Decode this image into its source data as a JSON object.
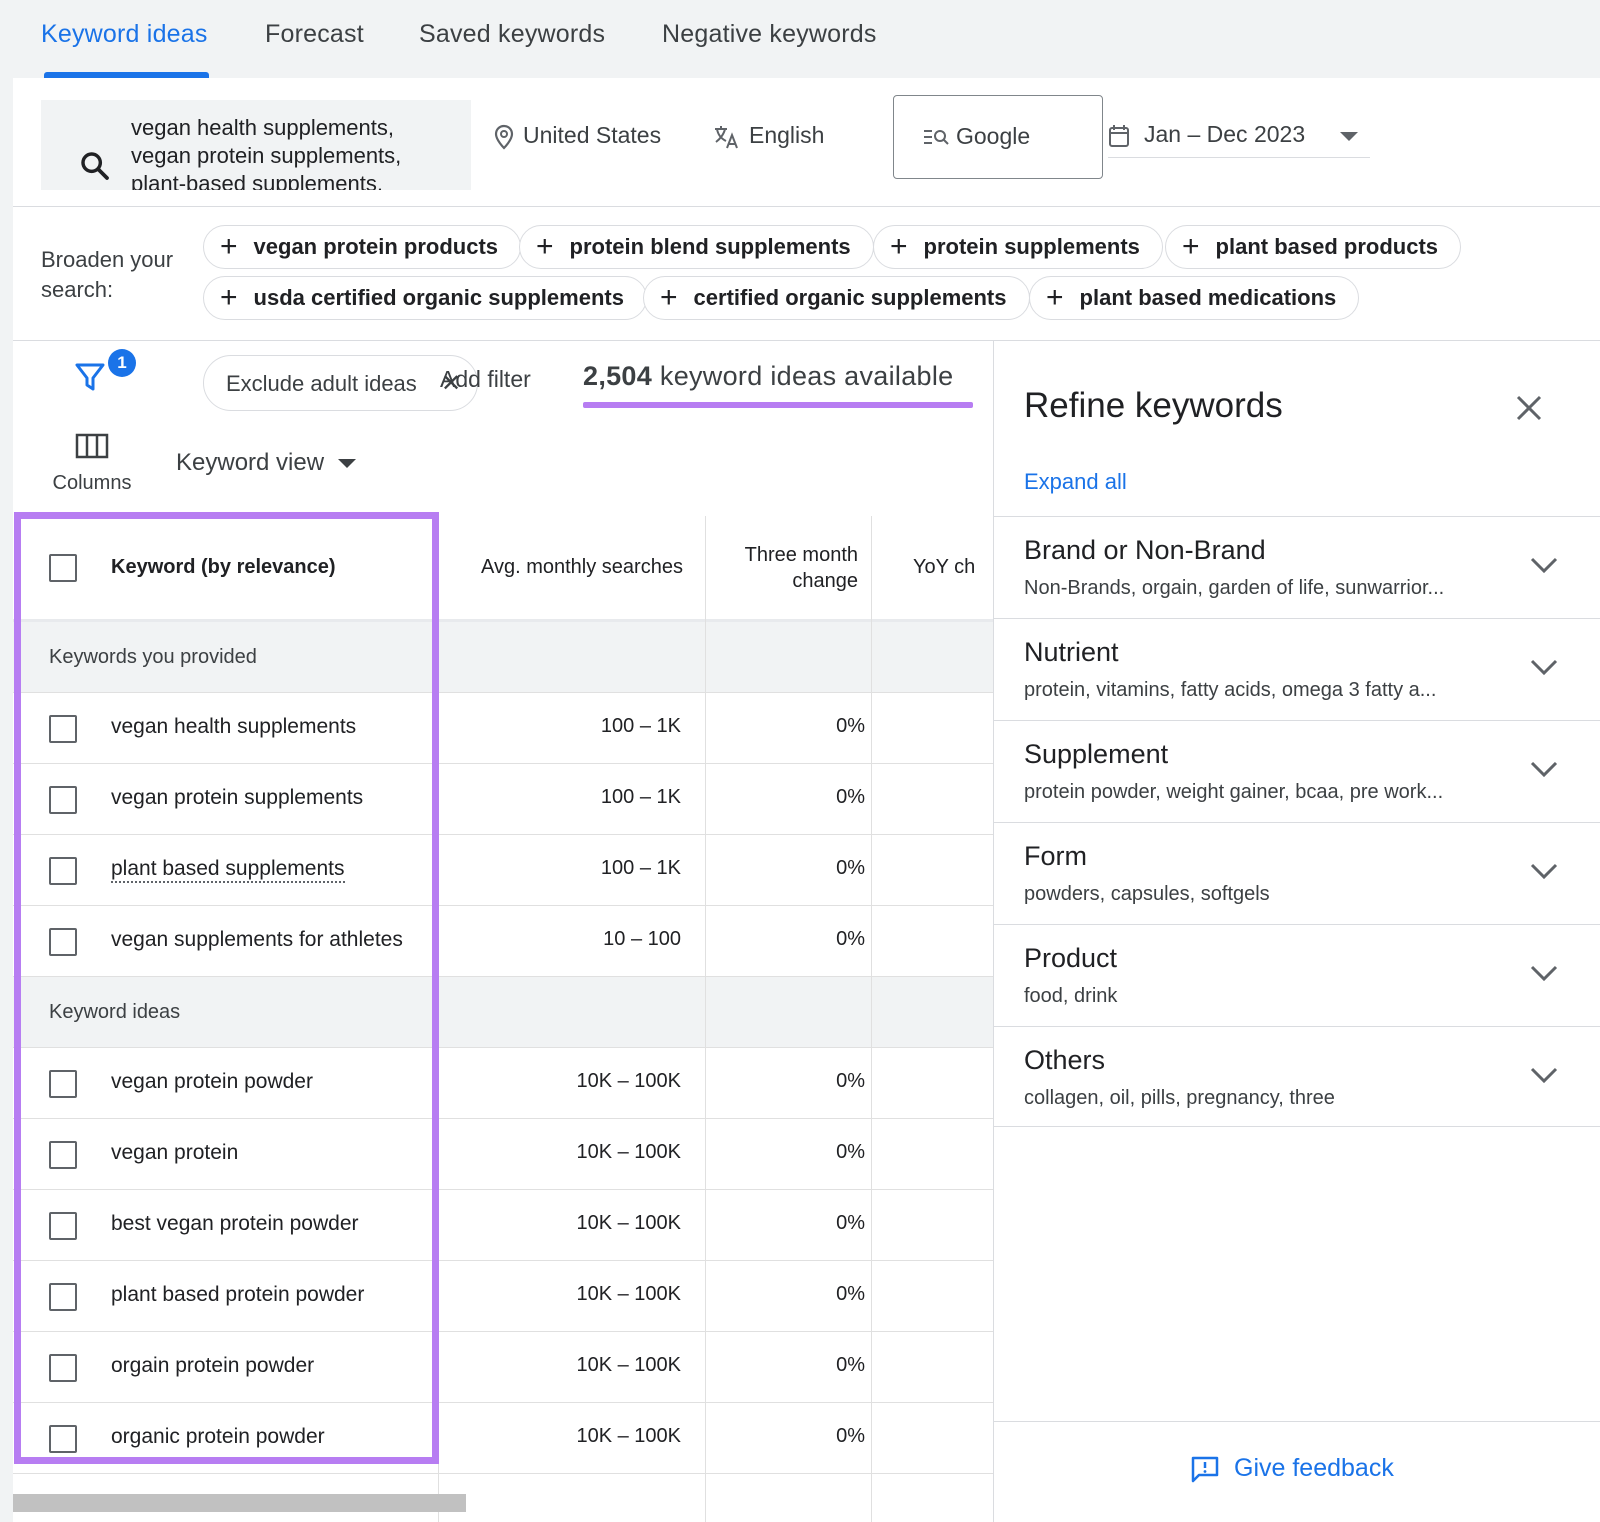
{
  "tabs": [
    {
      "label": "Keyword ideas"
    },
    {
      "label": "Forecast"
    },
    {
      "label": "Saved keywords"
    },
    {
      "label": "Negative keywords"
    }
  ],
  "search": {
    "lines": [
      "vegan health supplements,",
      "vegan protein supplements,",
      "plant-based supplements,"
    ]
  },
  "location": "United States",
  "language": "English",
  "network": "Google",
  "date_range": "Jan – Dec 2023",
  "broaden": {
    "label": "Broaden your search:",
    "chips": [
      "vegan protein products",
      "protein blend supplements",
      "protein supplements",
      "plant based products",
      "usda certified organic supplements",
      "certified organic supplements",
      "plant based medications"
    ]
  },
  "filters": {
    "badge": "1",
    "exclude_label": "Exclude adult ideas",
    "add_filter": "Add filter",
    "count_number": "2,504",
    "count_suffix": "keyword ideas available"
  },
  "columns_label": "Columns",
  "view_label": "Keyword view",
  "table": {
    "headers": {
      "keyword": "Keyword (by relevance)",
      "avg": "Avg. monthly searches",
      "three_month_1": "Three month",
      "three_month_2": "change",
      "yoy": "YoY ch"
    },
    "group_provided": "Keywords you provided",
    "group_ideas": "Keyword ideas",
    "provided": [
      {
        "keyword": "vegan health supplements",
        "avg": "100 – 1K",
        "change": "0%"
      },
      {
        "keyword": "vegan protein supplements",
        "avg": "100 – 1K",
        "change": "0%"
      },
      {
        "keyword": "plant based supplements",
        "avg": "100 – 1K",
        "change": "0%"
      },
      {
        "keyword": "vegan supplements for athletes",
        "avg": "10 – 100",
        "change": "0%"
      }
    ],
    "ideas": [
      {
        "keyword": "vegan protein powder",
        "avg": "10K – 100K",
        "change": "0%"
      },
      {
        "keyword": "vegan protein",
        "avg": "10K – 100K",
        "change": "0%"
      },
      {
        "keyword": "best vegan protein powder",
        "avg": "10K – 100K",
        "change": "0%"
      },
      {
        "keyword": "plant based protein powder",
        "avg": "10K – 100K",
        "change": "0%"
      },
      {
        "keyword": "orgain protein powder",
        "avg": "10K – 100K",
        "change": "0%"
      },
      {
        "keyword": "organic protein powder",
        "avg": "10K – 100K",
        "change": "0%"
      }
    ]
  },
  "refine": {
    "title": "Refine keywords",
    "expand_all": "Expand all",
    "categories": [
      {
        "name": "Brand or Non-Brand",
        "desc": "Non-Brands, orgain, garden of life, sunwarrior..."
      },
      {
        "name": "Nutrient",
        "desc": "protein, vitamins, fatty acids, omega 3 fatty a..."
      },
      {
        "name": "Supplement",
        "desc": "protein powder, weight gainer, bcaa, pre work..."
      },
      {
        "name": "Form",
        "desc": "powders, capsules, softgels"
      },
      {
        "name": "Product",
        "desc": "food, drink"
      },
      {
        "name": "Others",
        "desc": "collagen, oil, pills, pregnancy, three"
      }
    ],
    "feedback": "Give feedback"
  },
  "colors": {
    "accent": "#1a73e8",
    "highlight": "#b77df2"
  }
}
